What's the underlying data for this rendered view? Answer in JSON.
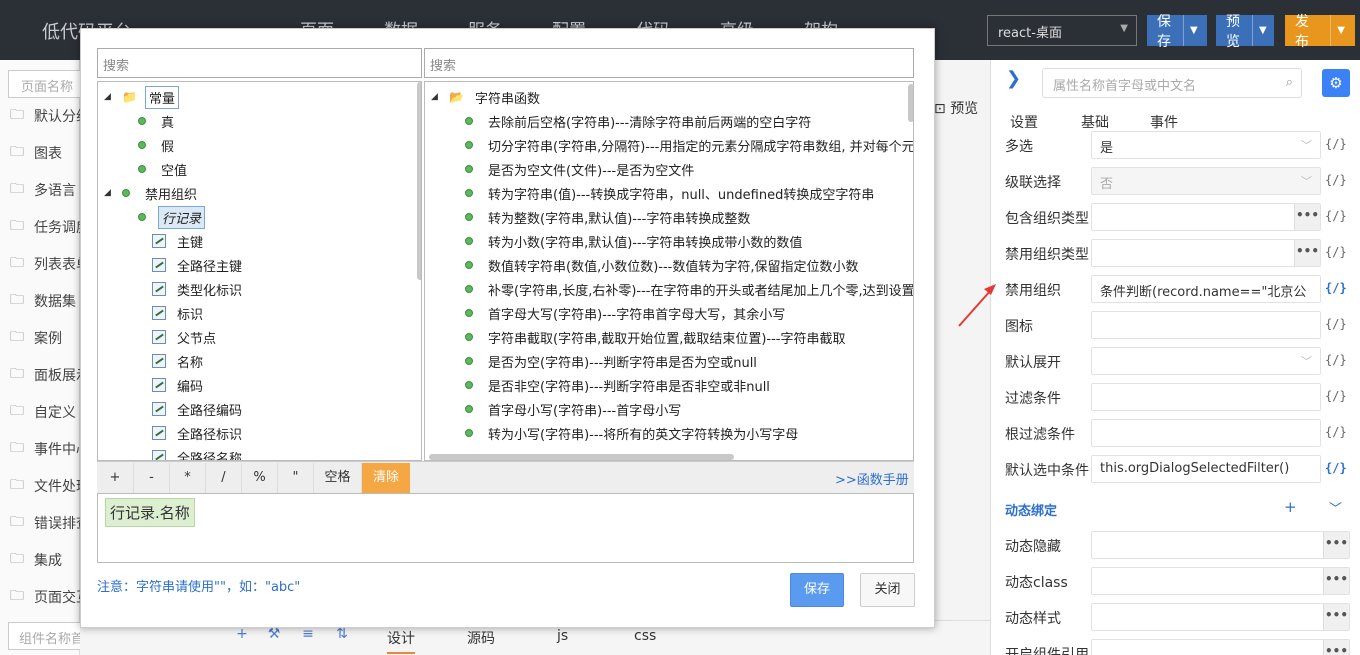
{
  "app": {
    "title": "低代码平台",
    "nav": [
      "页面",
      "数据",
      "服务",
      "配置",
      "代码",
      "高级",
      "架构"
    ],
    "platform": "react-桌面",
    "buttons": {
      "save": "保存",
      "preview": "预览",
      "publish": "发布"
    },
    "colors": {
      "topbar": "#2b2f36",
      "save": "#3b6fb8",
      "preview": "#3b6fb8",
      "publish": "#e8961e"
    }
  },
  "left": {
    "search_placeholder": "页面名称",
    "items": [
      "默认分组",
      "图表",
      "多语言",
      "任务调度",
      "列表表单",
      "数据集",
      "案例",
      "面板展示",
      "自定义",
      "事件中心",
      "文件处理",
      "错误排查",
      "集成",
      "页面交互"
    ],
    "bottom_search": "组件名称首字母或中文名"
  },
  "center": {
    "preview_label": "预览",
    "bottom_tabs": [
      "设计",
      "源码",
      "js",
      "css"
    ],
    "tools": [
      "+",
      "⚒",
      "≡",
      "⇅"
    ]
  },
  "right": {
    "search_placeholder": "属性名称首字母或中文名",
    "tabs": [
      "设置",
      "基础",
      "事件"
    ],
    "props": [
      {
        "label": "多选",
        "value": "是",
        "kind": "select",
        "disabled": false,
        "expr": false
      },
      {
        "label": "级联选择",
        "value": "否",
        "kind": "select",
        "disabled": true,
        "expr": false
      },
      {
        "label": "包含组织类型",
        "value": "",
        "kind": "dots",
        "disabled": false,
        "expr": false
      },
      {
        "label": "禁用组织类型",
        "value": "",
        "kind": "dots",
        "disabled": false,
        "expr": false
      },
      {
        "label": "禁用组织",
        "value": "条件判断(record.name==\"北京公",
        "kind": "text",
        "disabled": false,
        "expr": true
      },
      {
        "label": "图标",
        "value": "",
        "kind": "text",
        "disabled": false,
        "expr": false
      },
      {
        "label": "默认展开",
        "value": "",
        "kind": "select",
        "disabled": false,
        "expr": false
      },
      {
        "label": "过滤条件",
        "value": "",
        "kind": "text",
        "disabled": false,
        "expr": false
      },
      {
        "label": "根过滤条件",
        "value": "",
        "kind": "text",
        "disabled": false,
        "expr": false
      },
      {
        "label": "默认选中条件",
        "value": "this.orgDialogSelectedFilter()",
        "kind": "text",
        "disabled": false,
        "expr": true
      }
    ],
    "expr_label": "{/}",
    "section": "动态绑定",
    "section_add": "+",
    "section_toggle": "﹀",
    "binding_props": [
      {
        "label": "动态隐藏"
      },
      {
        "label": "动态class"
      },
      {
        "label": "动态样式"
      },
      {
        "label": "开启组件引用"
      }
    ]
  },
  "dialog": {
    "left_search": "搜索",
    "right_search": "搜索",
    "left_tree": [
      {
        "label": "常量",
        "type": "folder",
        "level": 0,
        "toggle": "◢",
        "style": "boxed"
      },
      {
        "label": "真",
        "type": "dot",
        "level": 1
      },
      {
        "label": "假",
        "type": "dot",
        "level": 1
      },
      {
        "label": "空值",
        "type": "dot",
        "level": 1
      },
      {
        "label": "禁用组织",
        "type": "dot",
        "level": 0,
        "toggle": "◢"
      },
      {
        "label": "行记录",
        "type": "dot",
        "level": 1,
        "style": "sel"
      },
      {
        "label": "主键",
        "type": "field",
        "level": 2
      },
      {
        "label": "全路径主键",
        "type": "field",
        "level": 2
      },
      {
        "label": "类型化标识",
        "type": "field",
        "level": 2
      },
      {
        "label": "标识",
        "type": "field",
        "level": 2
      },
      {
        "label": "父节点",
        "type": "field",
        "level": 2
      },
      {
        "label": "名称",
        "type": "field",
        "level": 2
      },
      {
        "label": "编码",
        "type": "field",
        "level": 2
      },
      {
        "label": "全路径编码",
        "type": "field",
        "level": 2
      },
      {
        "label": "全路径标识",
        "type": "field",
        "level": 2
      },
      {
        "label": "全路径名称",
        "type": "field",
        "level": 2
      }
    ],
    "right_tree": {
      "root": "字符串函数",
      "items": [
        "去除前后空格(字符串)---清除字符串前后两端的空白字符",
        "切分字符串(字符串,分隔符)---用指定的元素分隔成字符串数组, 并对每个元",
        "是否为空文件(文件)---是否为空文件",
        "转为字符串(值)---转换成字符串，null、undefined转换成空字符串",
        "转为整数(字符串,默认值)---字符串转换成整数",
        "转为小数(字符串,默认值)---字符串转换成带小数的数值",
        "数值转字符串(数值,小数位数)---数值转为字符,保留指定位数小数",
        "补零(字符串,长度,右补零)---在字符串的开头或者结尾加上几个零,达到设置",
        "首字母大写(字符串)---字符串首字母大写，其余小写",
        "字符串截取(字符串,截取开始位置,截取结束位置)---字符串截取",
        "是否为空(字符串)---判断字符串是否为空或null",
        "是否非空(字符串)---判断字符串是否非空或非null",
        "首字母小写(字符串)---首字母小写",
        "转为小写(字符串)---将所有的英文字符转换为小写字母"
      ]
    },
    "operators": [
      "+",
      "-",
      "*",
      "/",
      "%",
      "\"",
      "空格"
    ],
    "clear_label": "清除",
    "manual_link": ">>函数手册",
    "expression_token": "行记录.名称",
    "note": "注意：字符串请使用\"\"，如：\"abc\"",
    "save_label": "保存",
    "close_label": "关闭"
  }
}
